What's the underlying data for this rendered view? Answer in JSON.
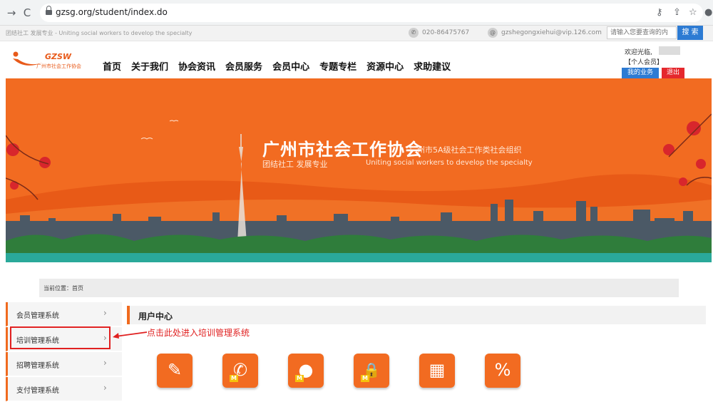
{
  "browser": {
    "back": "→",
    "reload": "C",
    "url": "gzsg.org/student/index.do",
    "icons": [
      "key-icon",
      "share-icon",
      "star-icon",
      "profile-icon"
    ]
  },
  "topbar": {
    "tagline": "团结社工 发展专业 - Uniting social workers to develop the specialty",
    "phone": "020-86475767",
    "email": "gzshegongxiehui@vip.126.com",
    "search_placeholder": "请输入您要查询的内",
    "search_button": "搜 索"
  },
  "header": {
    "logo_text": "GZSW",
    "logo_subtext": "广州市社会工作协会",
    "nav": [
      "首页",
      "关于我们",
      "协会资讯",
      "会员服务",
      "会员中心",
      "专题专栏",
      "资源中心",
      "求助建议"
    ],
    "welcome": "欢迎光临,",
    "member_type": "【个人会员】",
    "my_business": "我的业务",
    "logout": "退出"
  },
  "banner": {
    "title": "广州市社会工作协会",
    "subtitle": "广州市5A级社会工作类社会组织",
    "slogan_cn": "团结社工 发展专业",
    "slogan_en": "Uniting social workers to develop the specialty",
    "colors": {
      "bg": "#f26b21",
      "skyline": "#3d4e5c",
      "trees": "#2f7d3b",
      "water": "#2aa99a"
    }
  },
  "breadcrumb": "当前位置：首页",
  "sidebar": {
    "items": [
      {
        "label": "会员管理系统",
        "arrow": "›"
      },
      {
        "label": "培训管理系统",
        "arrow": "›"
      },
      {
        "label": "招聘管理系统",
        "arrow": "›"
      },
      {
        "label": "支付管理系统",
        "arrow": "›"
      }
    ]
  },
  "annotation": "点击此处进入培训管理系统",
  "main": {
    "section_title": "用户中心",
    "tiles": [
      {
        "icon": "notebook-icon",
        "glyph": "✎",
        "badge": ""
      },
      {
        "icon": "phone-icon",
        "glyph": "✆",
        "badge": "M"
      },
      {
        "icon": "user-icon",
        "glyph": "●",
        "badge": "M"
      },
      {
        "icon": "lock-icon",
        "glyph": "🔒",
        "badge": "M"
      },
      {
        "icon": "calendar-icon",
        "glyph": "▦",
        "badge": ""
      },
      {
        "icon": "growth-chart-icon",
        "glyph": "%",
        "badge": ""
      }
    ]
  },
  "accent_color": "#f06a1e"
}
